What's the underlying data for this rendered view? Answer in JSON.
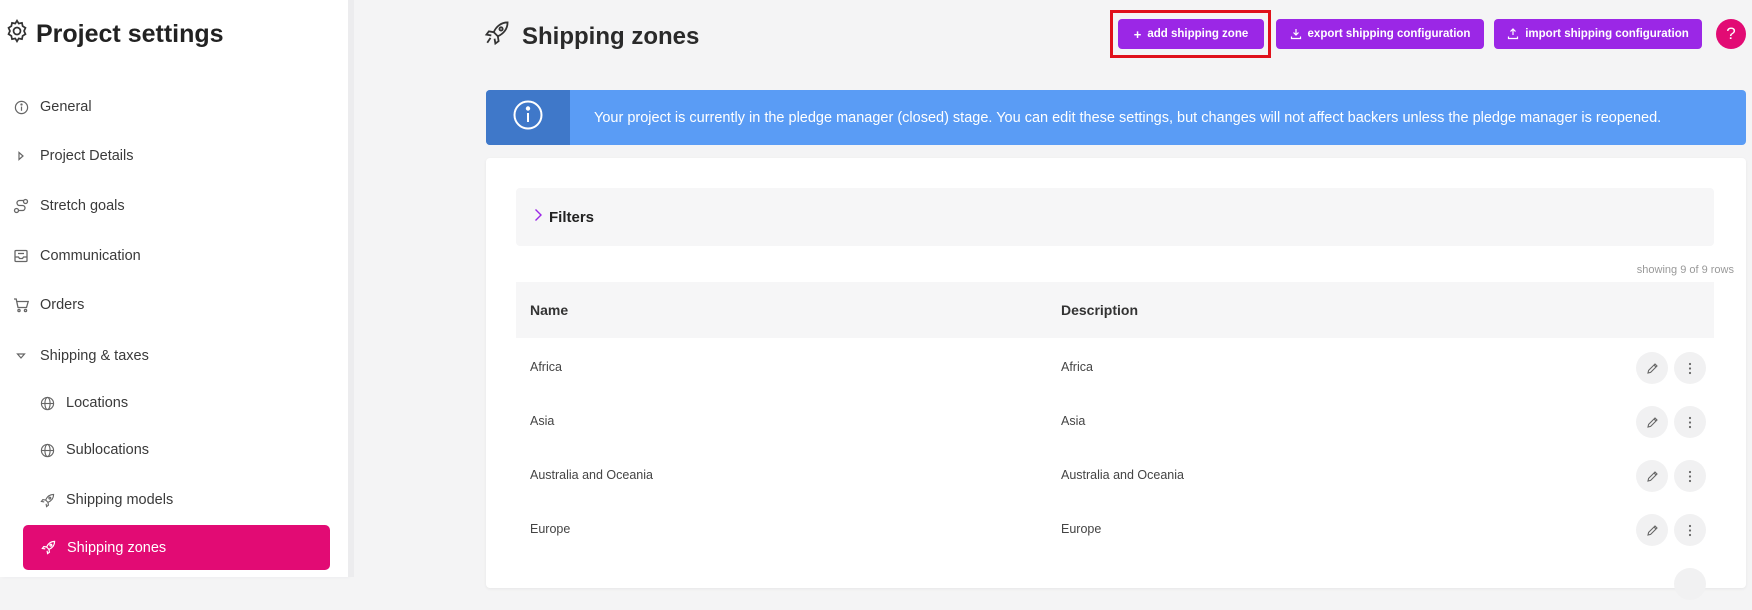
{
  "sidebar": {
    "title": "Project settings",
    "items": [
      {
        "label": "General"
      },
      {
        "label": "Project Details"
      },
      {
        "label": "Stretch goals"
      },
      {
        "label": "Communication"
      },
      {
        "label": "Orders"
      },
      {
        "label": "Shipping & taxes"
      },
      {
        "label": "Locations"
      },
      {
        "label": "Sublocations"
      },
      {
        "label": "Shipping models"
      },
      {
        "label": "Shipping zones"
      }
    ]
  },
  "header": {
    "title": "Shipping zones",
    "add_button": "add shipping zone",
    "export_button": "export shipping configuration",
    "import_button": "import shipping configuration",
    "help": "?"
  },
  "banner": {
    "text": "Your project is currently in the pledge manager (closed) stage. You can edit these settings, but changes will not affect backers unless the pledge manager is reopened."
  },
  "filters": {
    "label": "Filters"
  },
  "table": {
    "row_count": "showing 9 of 9 rows",
    "columns": [
      "Name",
      "Description"
    ],
    "rows": [
      {
        "name": "Africa",
        "description": "Africa"
      },
      {
        "name": "Asia",
        "description": "Asia"
      },
      {
        "name": "Australia and Oceania",
        "description": "Australia and Oceania"
      },
      {
        "name": "Europe",
        "description": "Europe"
      }
    ]
  },
  "colors": {
    "accent": "#9b27e6",
    "active_nav": "#e20b74",
    "banner": "#5a9cf5",
    "banner_dark": "#3f78c9",
    "highlight": "#e0111b"
  }
}
